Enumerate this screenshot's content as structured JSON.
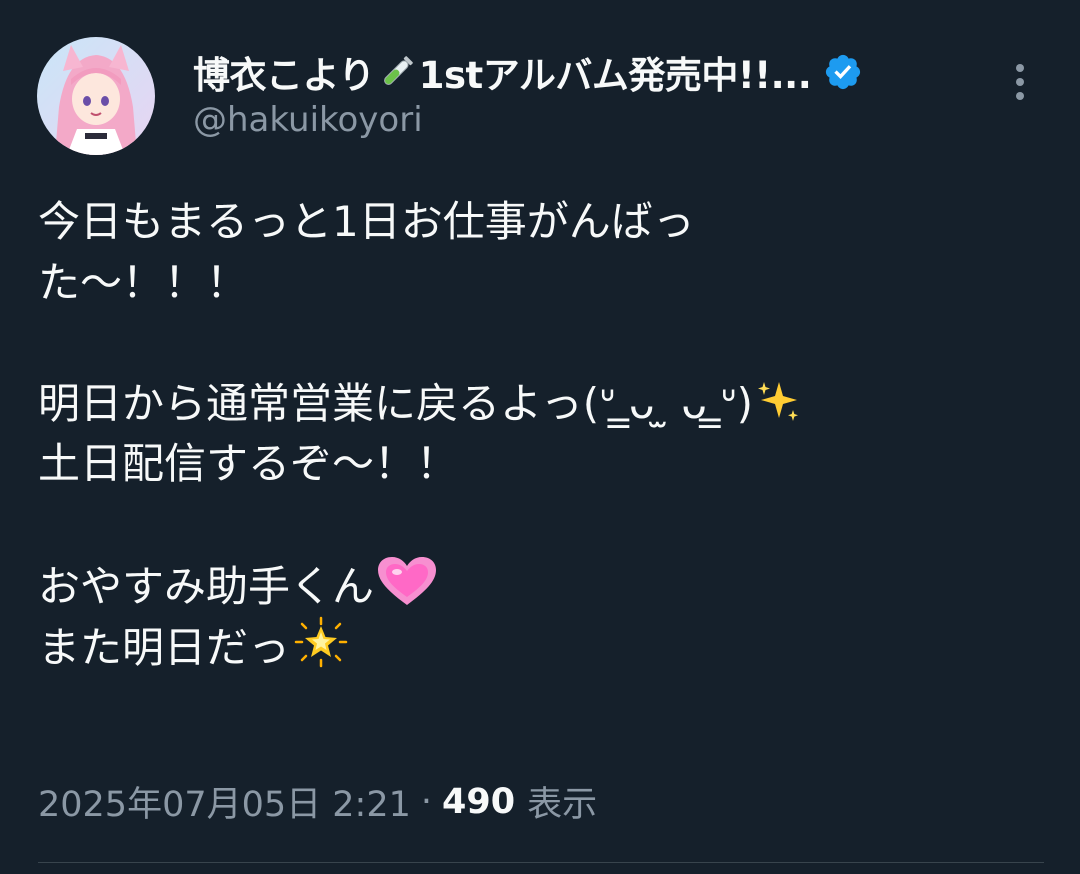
{
  "author": {
    "display_name": "博衣こより",
    "display_name_suffix": "1stアルバム発売中!!...",
    "name_emoji": "test-tube-icon",
    "handle": "@hakuikoyori",
    "verified": true
  },
  "tweet": {
    "lines": [
      "今日もまるっと1日お仕事がんばっ",
      "た〜！！！",
      "",
      "明日から通常営業に戻るよっ(ᐡ ̳ᴗ  ̫ ᴗ ̳ᐡ)",
      "土日配信するぞ〜！！",
      "",
      "おやすみ助手くん",
      "また明日だっ"
    ],
    "line_emojis": {
      "3": "sparkles-icon",
      "6": "growing-heart-icon",
      "7": "glowing-star-icon"
    }
  },
  "meta": {
    "timestamp": "2025年07月05日 2:21",
    "separator": "·",
    "views_count": "490",
    "views_label": "表示"
  },
  "colors": {
    "background": "#15202b",
    "primary_text": "#f7f9f9",
    "secondary_text": "#8b98a5",
    "verified_blue": "#1d9bf0",
    "divider": "#38444d"
  }
}
